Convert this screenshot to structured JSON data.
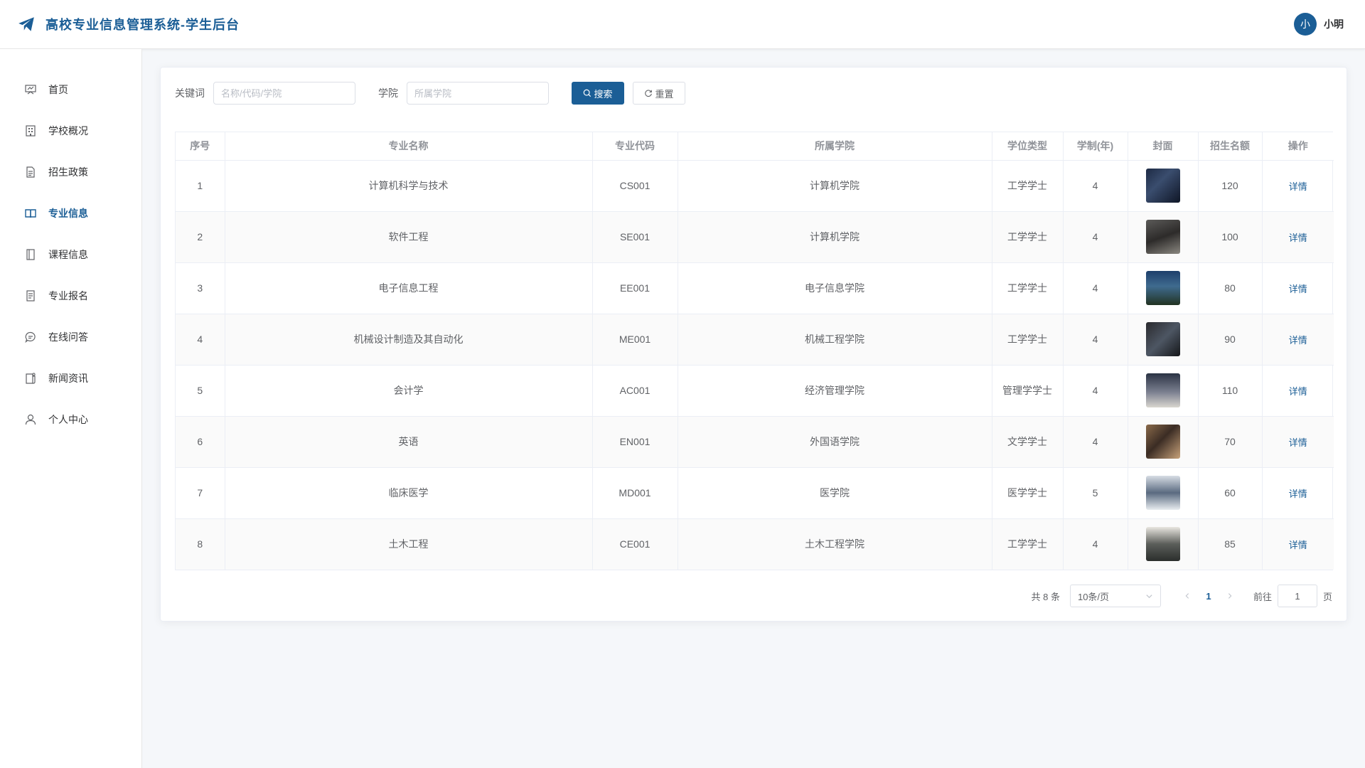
{
  "header": {
    "title": "高校专业信息管理系统-学生后台",
    "avatar_text": "小",
    "username": "小明"
  },
  "sidebar": {
    "items": [
      {
        "label": "首页",
        "icon": "home-icon"
      },
      {
        "label": "学校概况",
        "icon": "building-icon"
      },
      {
        "label": "招生政策",
        "icon": "document-icon"
      },
      {
        "label": "专业信息",
        "icon": "book-icon",
        "active": true
      },
      {
        "label": "课程信息",
        "icon": "notebook-icon"
      },
      {
        "label": "专业报名",
        "icon": "form-icon"
      },
      {
        "label": "在线问答",
        "icon": "chat-icon"
      },
      {
        "label": "新闻资讯",
        "icon": "news-icon"
      },
      {
        "label": "个人中心",
        "icon": "user-icon"
      }
    ]
  },
  "search": {
    "keyword_label": "关键词",
    "keyword_placeholder": "名称/代码/学院",
    "college_label": "学院",
    "college_placeholder": "所属学院",
    "search_label": "搜索",
    "reset_label": "重置"
  },
  "table": {
    "columns": [
      "序号",
      "专业名称",
      "专业代码",
      "所属学院",
      "学位类型",
      "学制(年)",
      "封面",
      "招生名额",
      "操作"
    ],
    "action_label": "详情",
    "rows": [
      {
        "no": "1",
        "name": "计算机科学与技术",
        "code": "CS001",
        "college": "计算机学院",
        "degree": "工学学士",
        "years": "4",
        "quota": "120"
      },
      {
        "no": "2",
        "name": "软件工程",
        "code": "SE001",
        "college": "计算机学院",
        "degree": "工学学士",
        "years": "4",
        "quota": "100"
      },
      {
        "no": "3",
        "name": "电子信息工程",
        "code": "EE001",
        "college": "电子信息学院",
        "degree": "工学学士",
        "years": "4",
        "quota": "80"
      },
      {
        "no": "4",
        "name": "机械设计制造及其自动化",
        "code": "ME001",
        "college": "机械工程学院",
        "degree": "工学学士",
        "years": "4",
        "quota": "90"
      },
      {
        "no": "5",
        "name": "会计学",
        "code": "AC001",
        "college": "经济管理学院",
        "degree": "管理学学士",
        "years": "4",
        "quota": "110"
      },
      {
        "no": "6",
        "name": "英语",
        "code": "EN001",
        "college": "外国语学院",
        "degree": "文学学士",
        "years": "4",
        "quota": "70"
      },
      {
        "no": "7",
        "name": "临床医学",
        "code": "MD001",
        "college": "医学院",
        "degree": "医学学士",
        "years": "5",
        "quota": "60"
      },
      {
        "no": "8",
        "name": "土木工程",
        "code": "CE001",
        "college": "土木工程学院",
        "degree": "工学学士",
        "years": "4",
        "quota": "85"
      }
    ]
  },
  "pagination": {
    "total": "共 8 条",
    "page_size": "10条/页",
    "current_page": "1",
    "goto_label": "前往",
    "goto_value": "1",
    "page_suffix": "页"
  },
  "colors": {
    "primary": "#1b5e96"
  }
}
